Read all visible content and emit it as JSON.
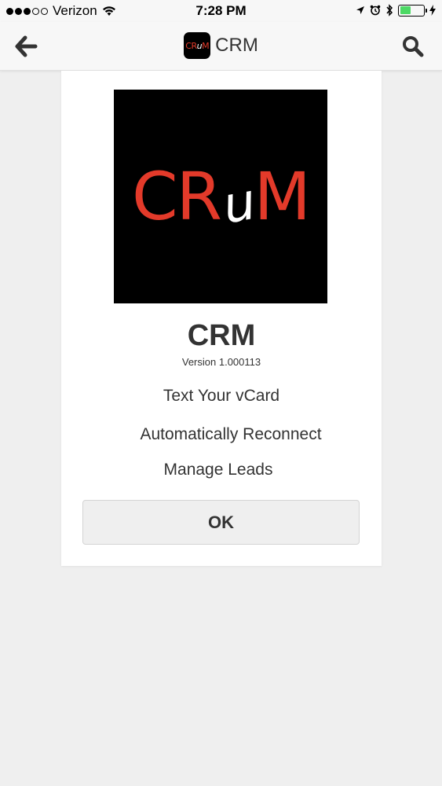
{
  "status_bar": {
    "carrier": "Verizon",
    "time": "7:28 PM"
  },
  "header": {
    "title": "CRM",
    "icon_text_left": "CR",
    "icon_text_u": "u",
    "icon_text_right": "M"
  },
  "card": {
    "logo_left": "CR",
    "logo_u": "u",
    "logo_right": "M",
    "app_name": "CRM",
    "version": "Version 1.000113",
    "features": [
      "Text Your vCard",
      "Automatically Reconnect",
      "Manage Leads"
    ],
    "ok_label": "OK"
  },
  "colors": {
    "brand_red": "#e33a2a",
    "background": "#efefef",
    "battery_green": "#4cd964"
  }
}
